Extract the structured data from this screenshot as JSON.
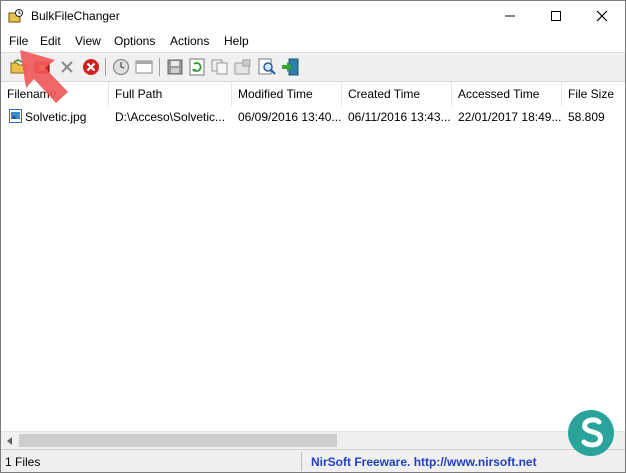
{
  "window": {
    "title": "BulkFileChanger",
    "minimize_symbol": "—",
    "maximize_symbol": "☐",
    "close_symbol": "✕"
  },
  "menu": [
    "File",
    "Edit",
    "View",
    "Options",
    "Actions",
    "Help"
  ],
  "toolbar_icons": [
    "open-folder-icon",
    "add-files-icon",
    "remove-icon",
    "clear-icon",
    "change-time-icon",
    "properties-window-icon",
    "save-icon",
    "refresh-icon",
    "copy-icon",
    "properties-icon",
    "find-icon",
    "exit-icon"
  ],
  "columns": [
    "Filename",
    "Full Path",
    "Modified Time",
    "Created Time",
    "Accessed Time",
    "File Size"
  ],
  "rows": [
    {
      "filename": "Solvetic.jpg",
      "full_path": "D:\\Acceso\\Solvetic...",
      "modified": "06/09/2016 13:40...",
      "created": "06/11/2016 13:43...",
      "accessed": "22/01/2017 18:49...",
      "size": "58.809"
    }
  ],
  "status": {
    "file_count": "1 Files",
    "credit": "NirSoft Freeware.  http://www.nirsoft.net"
  },
  "colors": {
    "accent_arrow": "#f05a5a",
    "status_link": "#1f3fbf",
    "logo_teal": "#2aa49a"
  }
}
